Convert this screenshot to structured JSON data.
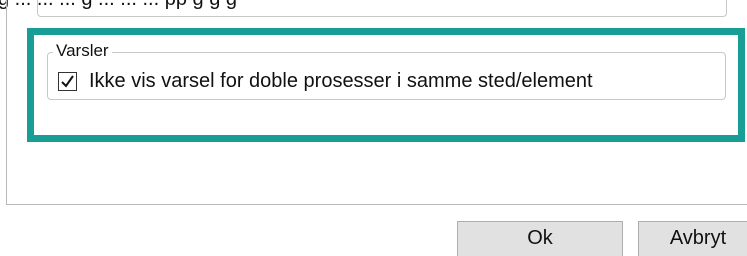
{
  "top_text": "g ... ... ... g ... ... ... pp g g g",
  "group": {
    "legend": "Varsler",
    "checkbox": {
      "label": "Ikke vis varsel for doble prosesser i samme sted/element",
      "checked": true
    }
  },
  "buttons": {
    "ok_label": "Ok",
    "cancel_label": "Avbryt"
  },
  "colors": {
    "highlight": "#189e94",
    "button_bg": "#e1e1e1",
    "border": "#c9c9c9"
  }
}
